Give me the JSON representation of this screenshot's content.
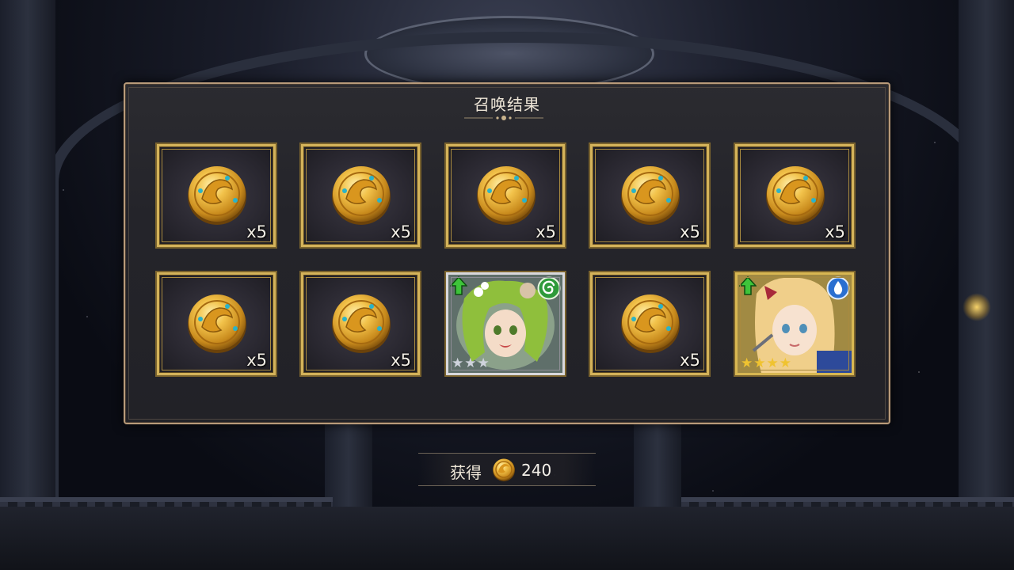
{
  "panel": {
    "title": "召唤结果"
  },
  "results": [
    {
      "type": "coin",
      "count": "x5"
    },
    {
      "type": "coin",
      "count": "x5"
    },
    {
      "type": "coin",
      "count": "x5"
    },
    {
      "type": "coin",
      "count": "x5"
    },
    {
      "type": "coin",
      "count": "x5"
    },
    {
      "type": "coin",
      "count": "x5"
    },
    {
      "type": "coin",
      "count": "x5"
    },
    {
      "type": "character",
      "element": "wind",
      "rarity": 3,
      "new": true
    },
    {
      "type": "coin",
      "count": "x5"
    },
    {
      "type": "character",
      "element": "water",
      "rarity": 4,
      "new": true
    }
  ],
  "gain": {
    "label": "获得",
    "value": "240",
    "icon": "gold-coin-icon"
  },
  "colors": {
    "frame_gold": "#d4b35a",
    "wind": "#3aa844",
    "water": "#2f7ed8",
    "star_gold": "#f0c330",
    "star_silver": "#cfd3dc"
  }
}
